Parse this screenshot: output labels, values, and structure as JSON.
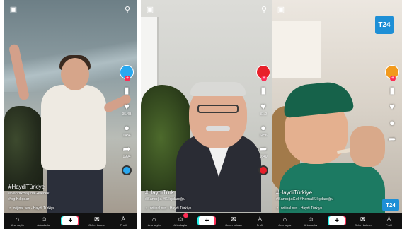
{
  "panels": [
    {
      "caption": {
        "hashtag": "#HaydiTürkiye",
        "line1": "#SandıkBaşınaGelecek",
        "line2": "#pg Kılıçdar"
      },
      "sound": "orijinal ses - Haydi Türkiye",
      "rail": {
        "likes": "95.4B",
        "comments": "1434",
        "shares": "1994"
      },
      "avatar_color": "#29a8f0",
      "disc_color": "#29a8f0"
    },
    {
      "caption": {
        "hashtag": "#HaydiTürk",
        "line1": "#Sandığa #Kılıçdaroğlu",
        "line2": ""
      },
      "sound": "orijinal ses - Haydi Türkiye",
      "rail": {
        "likes": "31.2",
        "comments": "1456",
        "shares": "1640"
      },
      "avatar_color": "#e8202a",
      "disc_color": "#e8202a"
    },
    {
      "caption": {
        "hashtag": "#HaydiTürkiye",
        "line1": "#SandığaGel #KemalKılıçdaroğlu",
        "line2": ""
      },
      "sound": "orijinal ses - Haydi Türkiye",
      "rail": {
        "likes": "",
        "comments": "",
        "shares": ""
      },
      "avatar_color": "#f29a1d",
      "disc_color": "#f29a1d",
      "logo": "T24"
    }
  ],
  "nav": {
    "items": [
      {
        "icon": "⌂",
        "label": "Ana sayfa"
      },
      {
        "icon": "☺",
        "label": "Arkadaşlar"
      },
      {
        "icon": "+",
        "label": ""
      },
      {
        "icon": "✉",
        "label": "Gelen kutusu"
      },
      {
        "icon": "♙",
        "label": "Profil"
      }
    ]
  },
  "icons": {
    "live": "▣",
    "search": "⚲",
    "heart": "♥",
    "comment": "●",
    "share": "➦",
    "bookmark": "▮",
    "note": "♫"
  },
  "colors": {
    "tiktok_red": "#fe2c55",
    "tiktok_cyan": "#25f4ee",
    "t24_blue": "#1e8fd6"
  }
}
